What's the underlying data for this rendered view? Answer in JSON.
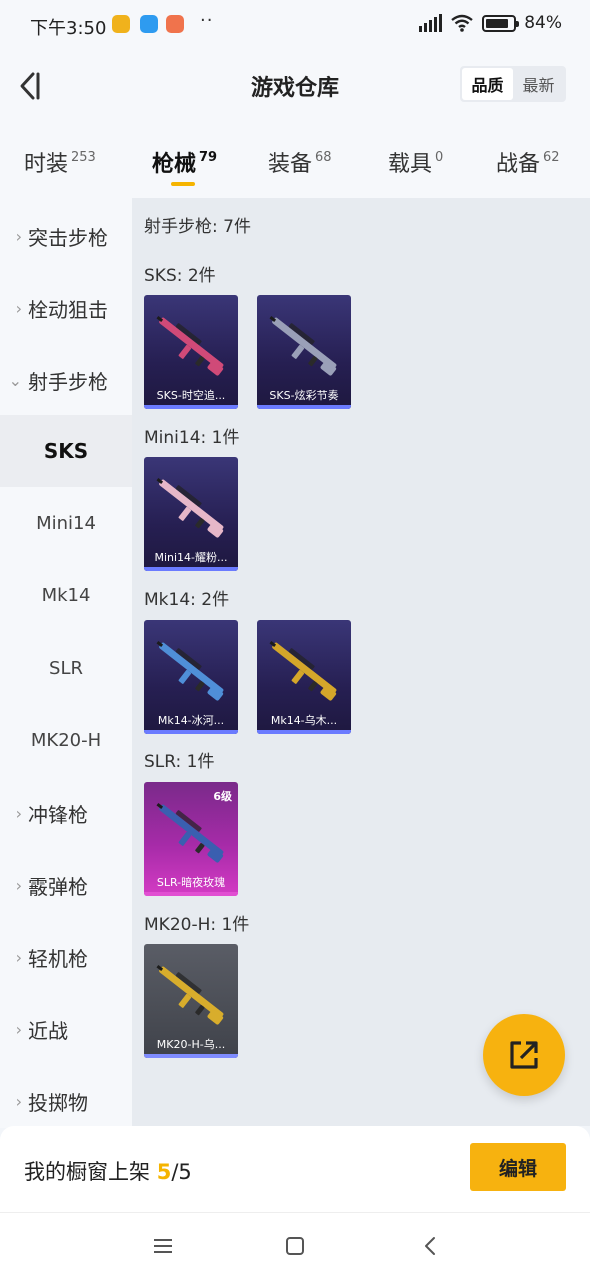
{
  "status_bar": {
    "time": "下午3:50",
    "battery": "84%",
    "battery_level": 0.84,
    "dots": "··"
  },
  "header": {
    "title": "游戏仓库",
    "sort_options": [
      "品质",
      "最新"
    ],
    "sort_selected": "品质"
  },
  "tabs": [
    {
      "label": "时装",
      "count": "253"
    },
    {
      "label": "枪械",
      "count": "79",
      "active": true
    },
    {
      "label": "装备",
      "count": "68"
    },
    {
      "label": "载具",
      "count": "0"
    },
    {
      "label": "战备",
      "count": "62"
    }
  ],
  "sidebar": {
    "categories": [
      "突击步枪",
      "栓动狙击",
      "射手步枪",
      "冲锋枪",
      "霰弹枪",
      "轻机枪",
      "近战",
      "投掷物"
    ],
    "expanded": "射手步枪",
    "subitems": [
      "SKS",
      "Mini14",
      "Mk14",
      "SLR",
      "MK20-H"
    ],
    "selected_subitem": "SKS"
  },
  "content": {
    "header": "射手步枪: 7件",
    "groups": [
      {
        "title": "SKS: 2件",
        "items": [
          {
            "name": "SKS-时空追...",
            "style": "purple",
            "gun_color": "#d04a78"
          },
          {
            "name": "SKS-炫彩节奏",
            "style": "purple",
            "gun_color": "#9aa0b8"
          }
        ]
      },
      {
        "title": "Mini14: 1件",
        "items": [
          {
            "name": "Mini14-耀粉...",
            "style": "purple",
            "gun_color": "#e6b7c8"
          }
        ]
      },
      {
        "title": "Mk14: 2件",
        "items": [
          {
            "name": "Mk14-冰河...",
            "style": "purple",
            "gun_color": "#4f8fd8"
          },
          {
            "name": "Mk14-乌木...",
            "style": "purple",
            "gun_color": "#d4a62a"
          }
        ]
      },
      {
        "title": "SLR: 1件",
        "items": [
          {
            "name": "SLR-暗夜玫瑰",
            "style": "pink",
            "gun_color": "#3a5fb0",
            "badge": "6级"
          }
        ]
      },
      {
        "title": "MK20-H: 1件",
        "items": [
          {
            "name": "MK20-H-乌...",
            "style": "grey",
            "gun_color": "#d8ad2c"
          }
        ]
      }
    ]
  },
  "bottom_bar": {
    "showcase_label": "我的橱窗上架",
    "showcase_current": "5",
    "showcase_total": "/5",
    "edit_button": "编辑"
  },
  "colors": {
    "accent": "#f5b400",
    "card_purple": "#2c2560",
    "card_pink": "#b92fb3",
    "card_grey": "#4e5159"
  }
}
